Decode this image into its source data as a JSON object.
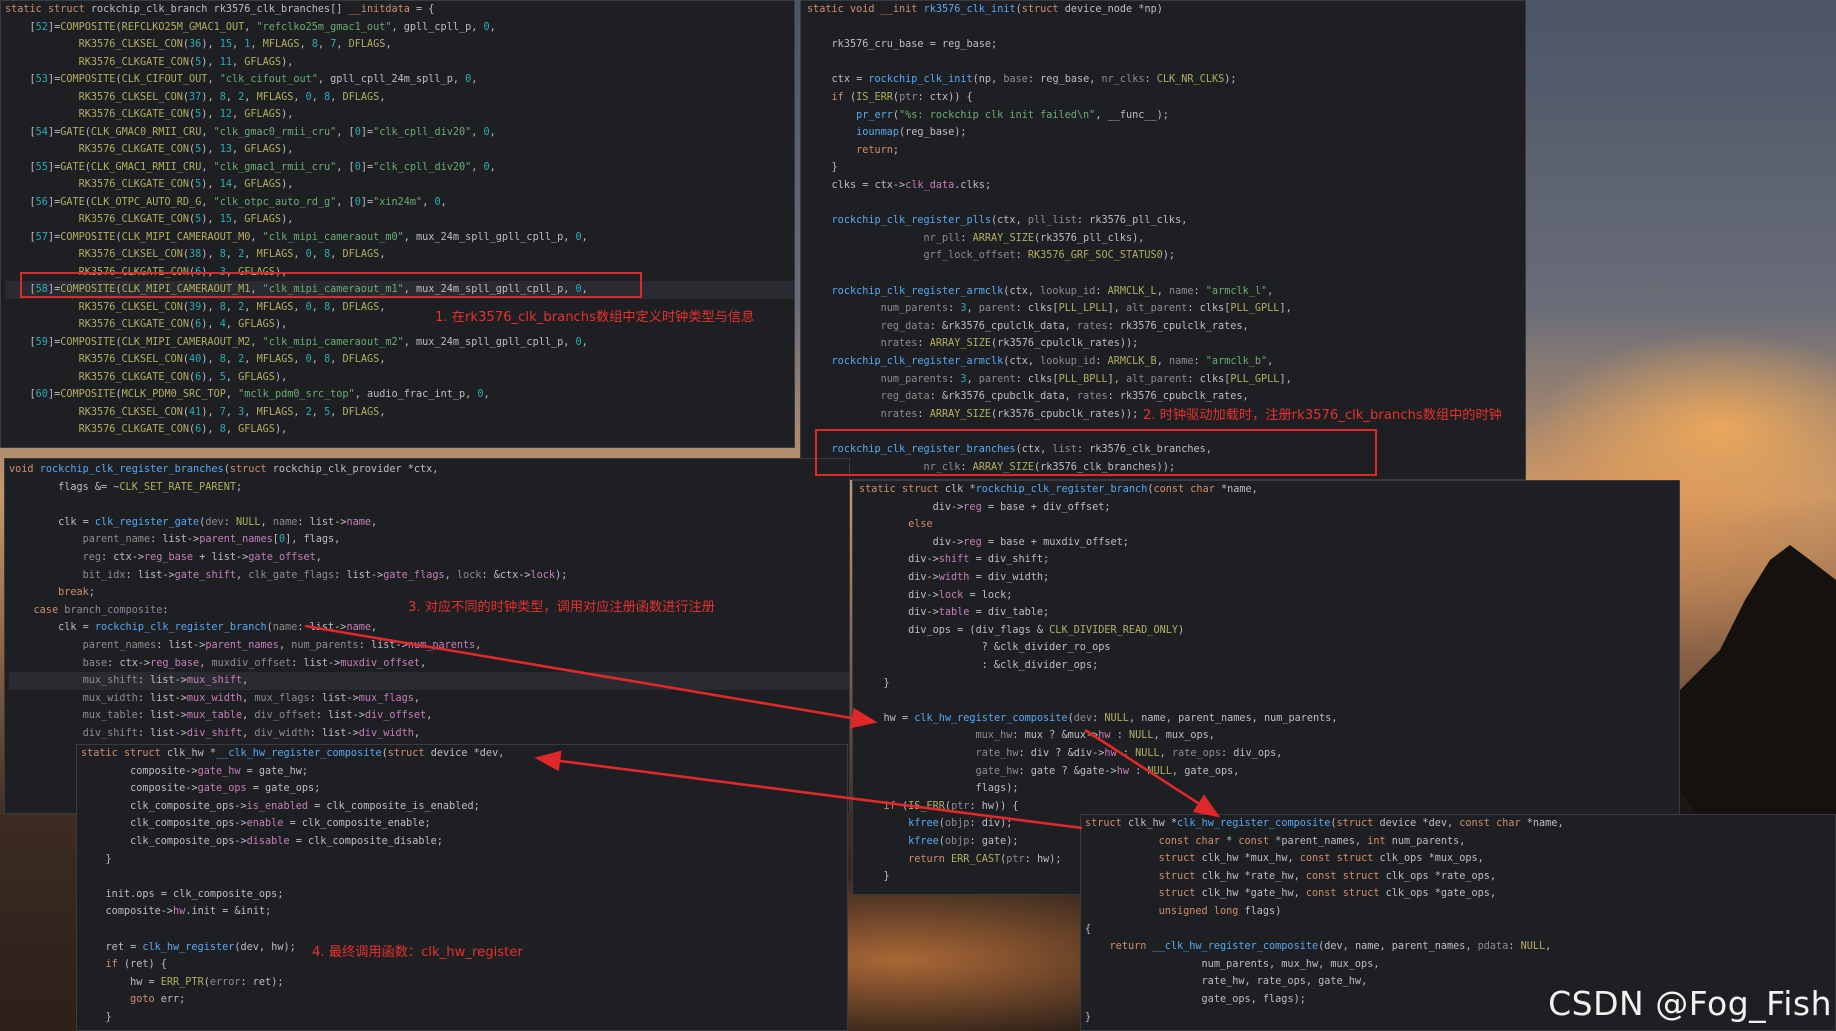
{
  "panels": {
    "p1": [
      "static struct rockchip_clk_branch rk3576_clk_branches[] __initdata = {",
      "    [52]=COMPOSITE(REFCLKO25M_GMAC1_OUT, \"refclko25m_gmac1_out\", gpll_cpll_p, 0,",
      "            RK3576_CLKSEL_CON(36), 15, 1, MFLAGS, 8, 7, DFLAGS,",
      "            RK3576_CLKGATE_CON(5), 11, GFLAGS),",
      "    [53]=COMPOSITE(CLK_CIFOUT_OUT, \"clk_cifout_out\", gpll_cpll_24m_spll_p, 0,",
      "            RK3576_CLKSEL_CON(37), 8, 2, MFLAGS, 0, 8, DFLAGS,",
      "            RK3576_CLKGATE_CON(5), 12, GFLAGS),",
      "    [54]=GATE(CLK_GMAC0_RMII_CRU, \"clk_gmac0_rmii_cru\", [0]=\"clk_cpll_div20\", 0,",
      "            RK3576_CLKGATE_CON(5), 13, GFLAGS),",
      "    [55]=GATE(CLK_GMAC1_RMII_CRU, \"clk_gmac1_rmii_cru\", [0]=\"clk_cpll_div20\", 0,",
      "            RK3576_CLKGATE_CON(5), 14, GFLAGS),",
      "    [56]=GATE(CLK_OTPC_AUTO_RD_G, \"clk_otpc_auto_rd_g\", [0]=\"xin24m\", 0,",
      "            RK3576_CLKGATE_CON(5), 15, GFLAGS),",
      "    [57]=COMPOSITE(CLK_MIPI_CAMERAOUT_M0, \"clk_mipi_cameraout_m0\", mux_24m_spll_gpll_cpll_p, 0,",
      "            RK3576_CLKSEL_CON(38), 8, 2, MFLAGS, 0, 8, DFLAGS,",
      "            RK3576_CLKGATE_CON(6), 3, GFLAGS),",
      "    [58]=COMPOSITE(CLK_MIPI_CAMERAOUT_M1, \"clk_mipi_cameraout_m1\", mux_24m_spll_gpll_cpll_p, 0,",
      "            RK3576_CLKSEL_CON(39), 8, 2, MFLAGS, 0, 8, DFLAGS,",
      "            RK3576_CLKGATE_CON(6), 4, GFLAGS),",
      "    [59]=COMPOSITE(CLK_MIPI_CAMERAOUT_M2, \"clk_mipi_cameraout_m2\", mux_24m_spll_gpll_cpll_p, 0,",
      "            RK3576_CLKSEL_CON(40), 8, 2, MFLAGS, 0, 8, DFLAGS,",
      "            RK3576_CLKGATE_CON(6), 5, GFLAGS),",
      "    [60]=COMPOSITE(MCLK_PDM0_SRC_TOP, \"mclk_pdm0_src_top\", audio_frac_int_p, 0,",
      "            RK3576_CLKSEL_CON(41), 7, 3, MFLAGS, 2, 5, DFLAGS,",
      "            RK3576_CLKGATE_CON(6), 8, GFLAGS),"
    ],
    "p2": [
      "static void __init rk3576_clk_init(struct device_node *np)",
      "",
      "    rk3576_cru_base = reg_base;",
      "",
      "    ctx = rockchip_clk_init(np, base: reg_base, nr_clks: CLK_NR_CLKS);",
      "    if (IS_ERR(ptr: ctx)) {",
      "        pr_err(\"%s: rockchip clk init failed\\n\", __func__);",
      "        iounmap(reg_base);",
      "        return;",
      "    }",
      "    clks = ctx->clk_data.clks;",
      "",
      "    rockchip_clk_register_plls(ctx, pll_list: rk3576_pll_clks,",
      "                   nr_pll: ARRAY_SIZE(rk3576_pll_clks),",
      "                   grf_lock_offset: RK3576_GRF_SOC_STATUS0);",
      "",
      "    rockchip_clk_register_armclk(ctx, lookup_id: ARMCLK_L, name: \"armclk_l\",",
      "            num_parents: 3, parent: clks[PLL_LPLL], alt_parent: clks[PLL_GPLL],",
      "            reg_data: &rk3576_cpulclk_data, rates: rk3576_cpulclk_rates,",
      "            nrates: ARRAY_SIZE(rk3576_cpulclk_rates));",
      "    rockchip_clk_register_armclk(ctx, lookup_id: ARMCLK_B, name: \"armclk_b\",",
      "            num_parents: 3, parent: clks[PLL_BPLL], alt_parent: clks[PLL_GPLL],",
      "            reg_data: &rk3576_cpubclk_data, rates: rk3576_cpubclk_rates,",
      "            nrates: ARRAY_SIZE(rk3576_cpubclk_rates));",
      "",
      "    rockchip_clk_register_branches(ctx, list: rk3576_clk_branches,",
      "                   nr_clk: ARRAY_SIZE(rk3576_clk_branches));"
    ],
    "p3": [
      "void rockchip_clk_register_branches(struct rockchip_clk_provider *ctx,",
      "        flags &= ~CLK_SET_RATE_PARENT;",
      "",
      "        clk = clk_register_gate(dev: NULL, name: list->name,",
      "            parent_name: list->parent_names[0], flags,",
      "            reg: ctx->reg_base + list->gate_offset,",
      "            bit_idx: list->gate_shift, clk_gate_flags: list->gate_flags, lock: &ctx->lock);",
      "        break;",
      "    case branch_composite:",
      "        clk = rockchip_clk_register_branch(name: list->name,",
      "            parent_names: list->parent_names, num_parents: list->num_parents,",
      "            base: ctx->reg_base, muxdiv_offset: list->muxdiv_offset,",
      "            mux_shift: list->mux_shift,",
      "            mux_width: list->mux_width, mux_flags: list->mux_flags,",
      "            mux_table: list->mux_table, div_offset: list->div_offset,",
      "            div_shift: list->div_shift, div_width: list->div_width,"
    ],
    "p4": [
      "static struct clk *rockchip_clk_register_branch(const char *name,",
      "            div->reg = base + div_offset;",
      "        else",
      "            div->reg = base + muxdiv_offset;",
      "        div->shift = div_shift;",
      "        div->width = div_width;",
      "        div->lock = lock;",
      "        div->table = div_table;",
      "        div_ops = (div_flags & CLK_DIVIDER_READ_ONLY)",
      "                    ? &clk_divider_ro_ops",
      "                    : &clk_divider_ops;",
      "    }",
      "",
      "    hw = clk_hw_register_composite(dev: NULL, name, parent_names, num_parents,",
      "                   mux_hw: mux ? &mux->hw : NULL, mux_ops,",
      "                   rate_hw: div ? &div->hw : NULL, rate_ops: div_ops,",
      "                   gate_hw: gate ? &gate->hw : NULL, gate_ops,",
      "                   flags);",
      "    if (IS_ERR(ptr: hw)) {",
      "        kfree(objp: div);",
      "        kfree(objp: gate);",
      "        return ERR_CAST(ptr: hw);",
      "    }"
    ],
    "p5": [
      "static struct clk_hw *__clk_hw_register_composite(struct device *dev,",
      "        composite->gate_hw = gate_hw;",
      "        composite->gate_ops = gate_ops;",
      "        clk_composite_ops->is_enabled = clk_composite_is_enabled;",
      "        clk_composite_ops->enable = clk_composite_enable;",
      "        clk_composite_ops->disable = clk_composite_disable;",
      "    }",
      "",
      "    init.ops = clk_composite_ops;",
      "    composite->hw.init = &init;",
      "",
      "    ret = clk_hw_register(dev, hw);",
      "    if (ret) {",
      "        hw = ERR_PTR(error: ret);",
      "        goto err;",
      "    }"
    ],
    "p6": [
      "struct clk_hw *clk_hw_register_composite(struct device *dev, const char *name,",
      "            const char * const *parent_names, int num_parents,",
      "            struct clk_hw *mux_hw, const struct clk_ops *mux_ops,",
      "            struct clk_hw *rate_hw, const struct clk_ops *rate_ops,",
      "            struct clk_hw *gate_hw, const struct clk_ops *gate_ops,",
      "            unsigned long flags)",
      "{",
      "    return __clk_hw_register_composite(dev, name, parent_names, pdata: NULL,",
      "                   num_parents, mux_hw, mux_ops,",
      "                   rate_hw, rate_ops, gate_hw,",
      "                   gate_ops, flags);",
      "}"
    ]
  },
  "annotations": {
    "a1": "1. 在rk3576_clk_branchs数组中定义时钟类型与信息",
    "a2": "2. 时钟驱动加载时，注册rk3576_clk_branchs数组中的时钟",
    "a3": "3. 对应不同的时钟类型，调用对应注册函数进行注册",
    "a4": "4. 最终调用函数：clk_hw_register"
  },
  "watermark": "CSDN @Fog_Fish",
  "colors": {
    "editor_bg": "#1e1f22",
    "annotation_red": "#e8302f",
    "keyword": "#cf8e6d",
    "function": "#56a8f5",
    "string": "#6aab73",
    "number": "#2aacb8"
  }
}
